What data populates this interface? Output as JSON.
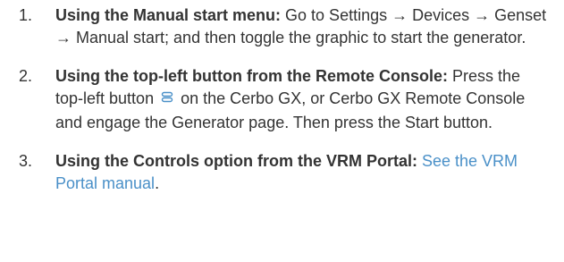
{
  "steps": [
    {
      "number": "1.",
      "lead": "Using the Manual start menu:",
      "text": " Go to Settings → Devices → Genset → Manual start; and then toggle the graphic to start the generator."
    },
    {
      "number": "2.",
      "lead": "Using the top-left button from the Remote Console:",
      "text_before_icon": " Press the top-left button",
      "icon": "menu-button-icon",
      "text_after_icon": "on the Cerbo GX, or Cerbo GX Remote Console and engage the Generator page. Then press the Start button."
    },
    {
      "number": "3.",
      "lead": "Using the Controls option from the VRM Portal:",
      "text": " ",
      "link": "See the VRM Portal manual",
      "text_after_link": "."
    }
  ],
  "colors": {
    "text": "#333333",
    "link": "#4a90c8"
  }
}
